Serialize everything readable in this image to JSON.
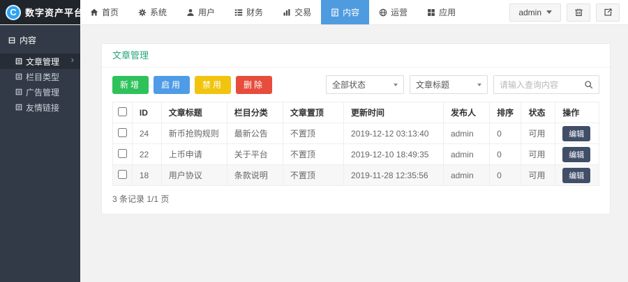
{
  "brand": {
    "title": "数字资产平台",
    "logo_letter": "C"
  },
  "navbar": {
    "items": [
      {
        "label": "首页",
        "icon": "home-icon",
        "active": false
      },
      {
        "label": "系统",
        "icon": "gear-icon",
        "active": false
      },
      {
        "label": "用户",
        "icon": "user-icon",
        "active": false
      },
      {
        "label": "财务",
        "icon": "list-icon",
        "active": false
      },
      {
        "label": "交易",
        "icon": "chart-icon",
        "active": false
      },
      {
        "label": "内容",
        "icon": "file-icon",
        "active": true
      },
      {
        "label": "运营",
        "icon": "globe-icon",
        "active": false
      },
      {
        "label": "应用",
        "icon": "grid-icon",
        "active": false
      }
    ],
    "user_menu": {
      "label": "admin",
      "icons": [
        "trash-icon",
        "logout-icon"
      ]
    }
  },
  "sidebar": {
    "section_title": "内容",
    "items": [
      {
        "label": "文章管理",
        "active": true,
        "chevron": "›"
      },
      {
        "label": "栏目类型",
        "active": false
      },
      {
        "label": "广告管理",
        "active": false
      },
      {
        "label": "友情链接",
        "active": false
      }
    ]
  },
  "main": {
    "page_title": "文章管理",
    "toolbar": {
      "add_label": "新增",
      "enable_label": "启用",
      "disable_label": "禁用",
      "delete_label": "删除"
    },
    "filters": {
      "status_select_value": "全部状态",
      "field_select_value": "文章标题",
      "search_placeholder": "请输入查询内容"
    },
    "table": {
      "headers": [
        "ID",
        "文章标题",
        "栏目分类",
        "文章置顶",
        "更新时间",
        "发布人",
        "排序",
        "状态",
        "操作"
      ],
      "edit_label": "编辑",
      "rows": [
        {
          "id": "24",
          "title": "新币抢购规则",
          "category": "最新公告",
          "top": "不置顶",
          "updated": "2019-12-12 03:13:40",
          "publisher": "admin",
          "sort": "0",
          "status": "可用"
        },
        {
          "id": "22",
          "title": "上币申请",
          "category": "关于平台",
          "top": "不置顶",
          "updated": "2019-12-10 18:49:35",
          "publisher": "admin",
          "sort": "0",
          "status": "可用"
        },
        {
          "id": "18",
          "title": "用户协议",
          "category": "条款说明",
          "top": "不置顶",
          "updated": "2019-11-28 12:35:56",
          "publisher": "admin",
          "sort": "0",
          "status": "可用"
        }
      ]
    },
    "footer_summary": "3 条记录 1/1 页"
  },
  "colors": {
    "nav_active": "#4f9be0",
    "sidebar_bg": "#313a46",
    "sidebar_active_bg": "#262d37",
    "page_title": "#27a57c",
    "btn_add": "#2fc25b",
    "btn_enable": "#4f9ce6",
    "btn_disable": "#f1c40f",
    "btn_delete": "#e74c3c",
    "edit_btn": "#414e68",
    "logo_circle": "#2da4f2",
    "topbar_bg": "#ffffff",
    "body_bg": "#f2f2f2"
  }
}
